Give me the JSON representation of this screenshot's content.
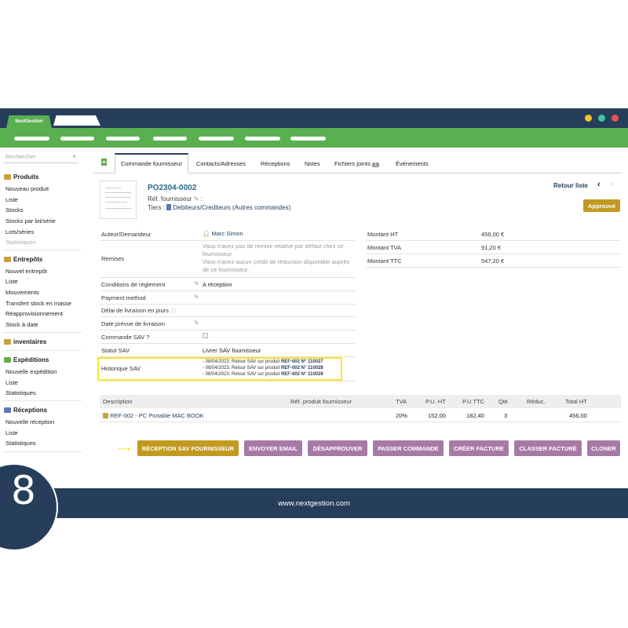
{
  "app": {
    "tab_title": "NextGestion"
  },
  "window_colors": {
    "dot1": "#f2c12e",
    "dot2": "#3ec79a",
    "dot3": "#e8524f",
    "frame": "#263e5a",
    "accent": "#5aaf51"
  },
  "sidebar": {
    "search_placeholder": "Rechercher",
    "sections": [
      {
        "title": "Produits",
        "items": [
          "Nouveau produit",
          "Liste",
          "Stocks",
          "Stocks par lot/série",
          "Lots/séries",
          "Statistiques"
        ]
      },
      {
        "title": "Entrepôts",
        "items": [
          "Nouvel entrepôt",
          "Liste",
          "Mouvements",
          "Transfert stock en masse",
          "Réapprovisionnement",
          "Stock à date"
        ]
      },
      {
        "title": "inventaires",
        "items": []
      },
      {
        "title": "Expéditions",
        "items": [
          "Nouvelle expédition",
          "Liste",
          "Statistiques"
        ]
      },
      {
        "title": "Réceptions",
        "items": [
          "Nouvelle réception",
          "Liste",
          "Statistiques"
        ]
      }
    ]
  },
  "tabs": [
    "Commande fournisseur",
    "Contacts/Adresses",
    "Réceptions",
    "Notes",
    "Fichiers joints",
    "Événements"
  ],
  "attachments_count": "1",
  "header": {
    "ref": "PO2304-0002",
    "ref_supplier_label": "Réf. fournisseur",
    "ref_supplier_suffix": ":",
    "tiers_label": "Tiers :",
    "tiers_value": "Debiteurs/Crediteurs (Autres commandes)",
    "back_label": "Retour liste",
    "prev": "‹",
    "next": "›",
    "status": "Approuvé"
  },
  "fields": {
    "author_label": "Auteur/Demandeur",
    "author_value": "Marc Simon",
    "discount_label": "Remises",
    "discount_line1": "Vous n'avez pas de remise relative par défaut chez ce fournisseur.",
    "discount_line2": "Vous n'avez aucun crédit de réduction disponible auprès de ce fournisseur.",
    "payment_terms_label": "Conditions de règlement",
    "payment_terms_value": "A réception",
    "payment_method_label": "Payment method",
    "delivery_delay_label": "Délai de livraison en jours",
    "delivery_date_label": "Date prévue de livraison",
    "sav_order_label": "Commande SAV ?",
    "sav_status_label": "Statut SAV",
    "sav_status_value": "Livrer SAV fournisseur",
    "sav_history_label": "Historique SAV",
    "sav_history": [
      {
        "prefix": "- 08/04/2023: Retour SAV sur produit",
        "product": "REF-002",
        "mid": "N°",
        "num": "110027"
      },
      {
        "prefix": "- 08/04/2023: Retour SAV sur produit",
        "product": "REF-002",
        "mid": "N°",
        "num": "110028"
      },
      {
        "prefix": "- 08/04/2023: Retour SAV sur produit",
        "product": "REF-002",
        "mid": "N°",
        "num": "110029"
      }
    ]
  },
  "amounts": {
    "ht_label": "Montant HT",
    "ht_value": "456,00 €",
    "tva_label": "Montant TVA",
    "tva_value": "91,20 €",
    "ttc_label": "Montant TTC",
    "ttc_value": "547,20 €"
  },
  "lines_table": {
    "headers": [
      "Description",
      "Réf. produit fournisseur",
      "TVA",
      "P.U. HT",
      "P.U TTC",
      "Qté",
      "Réduc.",
      "Total HT"
    ],
    "rows": [
      {
        "description": "REF-002 - PC Portable MAC BOOK",
        "ref_supplier": "",
        "tva": "20%",
        "pu_ht": "152,00",
        "pu_ttc": "182,40",
        "qty": "3",
        "discount": "",
        "total_ht": "456,00"
      }
    ]
  },
  "actions": {
    "reception_sav": "RÉCEPTION SAV FOURNISSEUR",
    "send_email": "ENVOYER EMAIL",
    "disapprove": "DÉSAPPROUVER",
    "place_order": "PASSER COMMANDE",
    "create_invoice": "CRÉER FACTURE",
    "classify_billed": "CLASSER FACTURÉ",
    "clone": "CLONER"
  },
  "footer": {
    "url": "www.nextgestion.com",
    "step_number": "8"
  }
}
